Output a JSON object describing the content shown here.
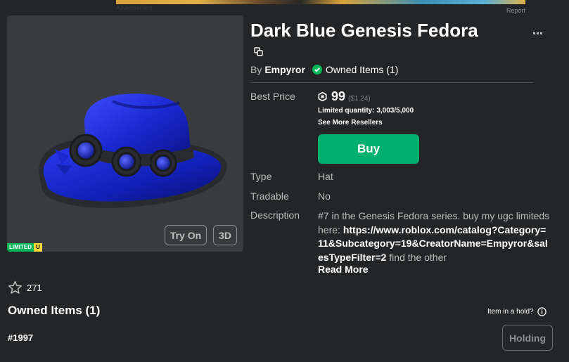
{
  "ad": {
    "label": "Advertisement",
    "report": "Report"
  },
  "item": {
    "title": "Dark Blue Genesis Fedora",
    "by_label": "By",
    "creator": "Empyror",
    "owned_label": "Owned Items (1)",
    "best_price_label": "Best Price",
    "price": "99",
    "price_usd": "($1.24)",
    "limited_quantity": "Limited quantity: 3,003/5,000",
    "see_more": "See More Resellers",
    "buy_label": "Buy",
    "type_label": "Type",
    "type_value": "Hat",
    "tradable_label": "Tradable",
    "tradable_value": "No",
    "description_label": "Description",
    "description_text": "#7 in the Genesis Fedora series. buy my ugc limiteds here: ",
    "description_link": "https://www.roblox.com/catalog?Category=11&Subcategory=19&CreatorName=Empyror&salesTypeFilter=2",
    "description_tail": " find the other",
    "read_more": "Read More"
  },
  "thumbnail": {
    "try_on": "Try On",
    "view_3d": "3D",
    "badge_limited": "LIMITED",
    "badge_u": "U"
  },
  "favorites": {
    "count": "271"
  },
  "owned_section": {
    "heading": "Owned Items (1)",
    "hold_question": "Item in a hold?",
    "serial": "#1997",
    "holding_label": "Holding"
  },
  "colors": {
    "background": "#232527",
    "buy_green": "#00b06f",
    "check_green": "#02b757",
    "hat_blue": "#1c2bd6"
  },
  "icons": [
    "copy-icon",
    "check-circle-icon",
    "robux-icon",
    "star-icon",
    "info-icon",
    "more-icon"
  ]
}
